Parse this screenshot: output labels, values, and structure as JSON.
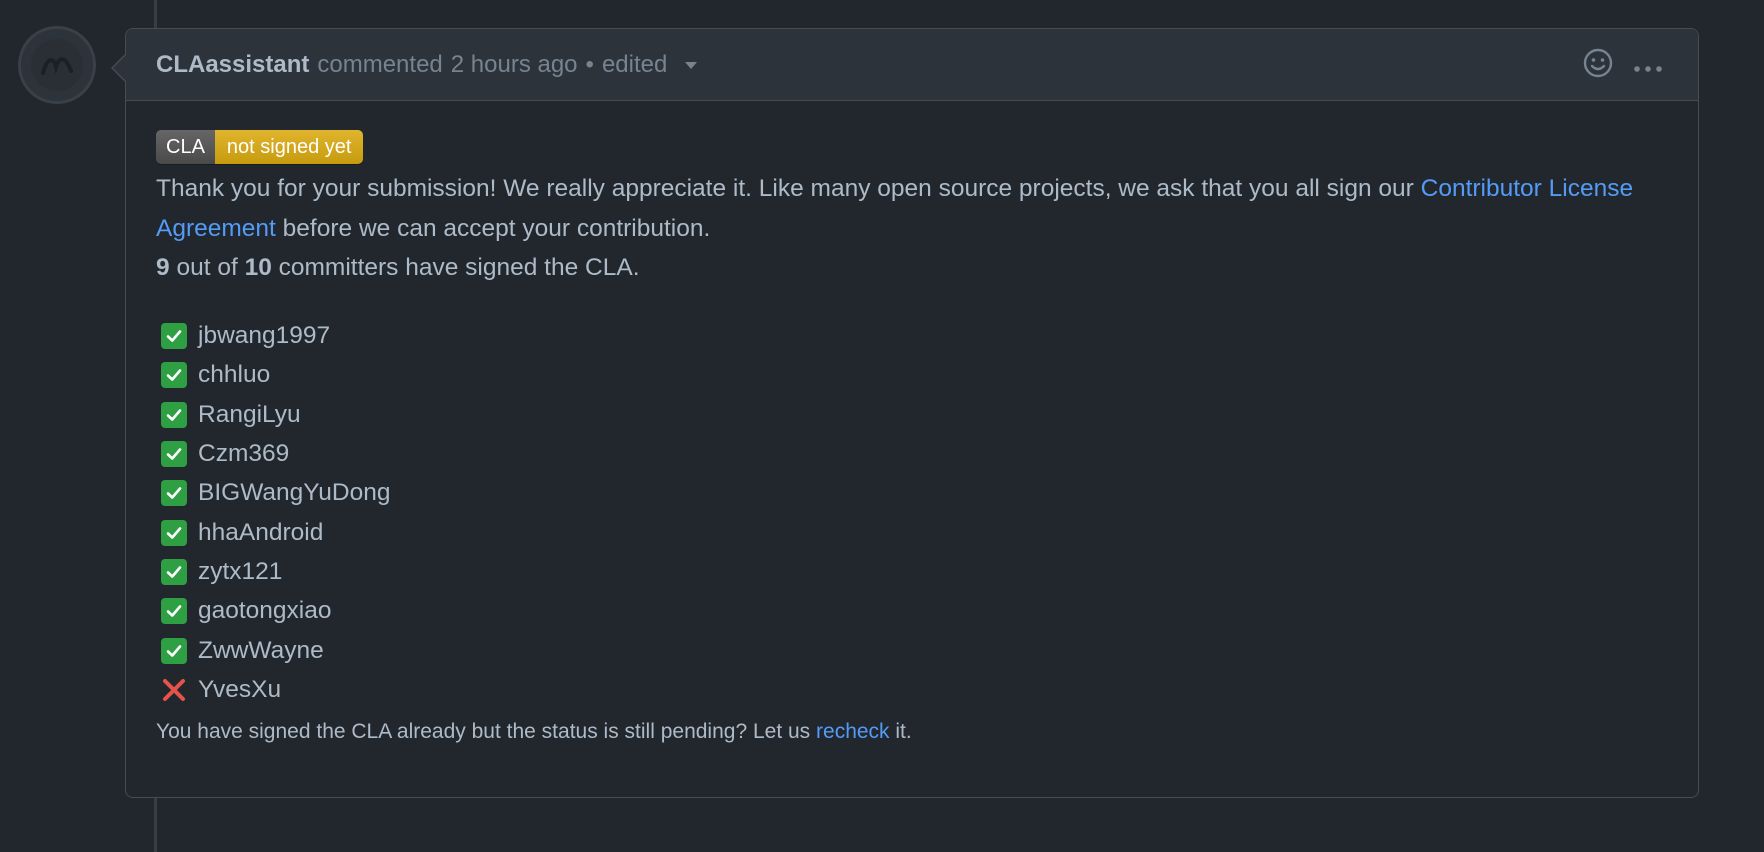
{
  "comment": {
    "author": "CLAassistant",
    "action": "commented",
    "time": "2 hours ago",
    "separator": "•",
    "edited": "edited"
  },
  "badge": {
    "left": "CLA",
    "right": "not signed yet"
  },
  "body": {
    "intro_text": "Thank you for your submission! We really appreciate it. Like many open source projects, we ask that you all sign our ",
    "link_text": "Contributor License Agreement",
    "intro_suffix": " before we can accept your contribution.",
    "signed_count": "9",
    "count_mid": " out of ",
    "total_count": "10",
    "count_suffix": " committers have signed the CLA."
  },
  "committers": [
    {
      "name": "jbwang1997",
      "signed": true
    },
    {
      "name": "chhluo",
      "signed": true
    },
    {
      "name": "RangiLyu",
      "signed": true
    },
    {
      "name": "Czm369",
      "signed": true
    },
    {
      "name": "BIGWangYuDong",
      "signed": true
    },
    {
      "name": "hhaAndroid",
      "signed": true
    },
    {
      "name": "zytx121",
      "signed": true
    },
    {
      "name": "gaotongxiao",
      "signed": true
    },
    {
      "name": "ZwwWayne",
      "signed": true
    },
    {
      "name": "YvesXu",
      "signed": false
    }
  ],
  "footer": {
    "prefix": "You have signed the CLA already but the status is still pending? Let us ",
    "link": "recheck",
    "suffix": " it."
  },
  "icons": {
    "reaction": "smiley-icon",
    "more": "kebab-horizontal-icon",
    "signed": "check-icon",
    "unsigned": "x-icon"
  },
  "colors": {
    "background": "#22272e",
    "header": "#2d333b",
    "link": "#539bf5",
    "check": "#2ea043",
    "cross": "#e5534b",
    "badge_yellow": "#d4a72c"
  }
}
